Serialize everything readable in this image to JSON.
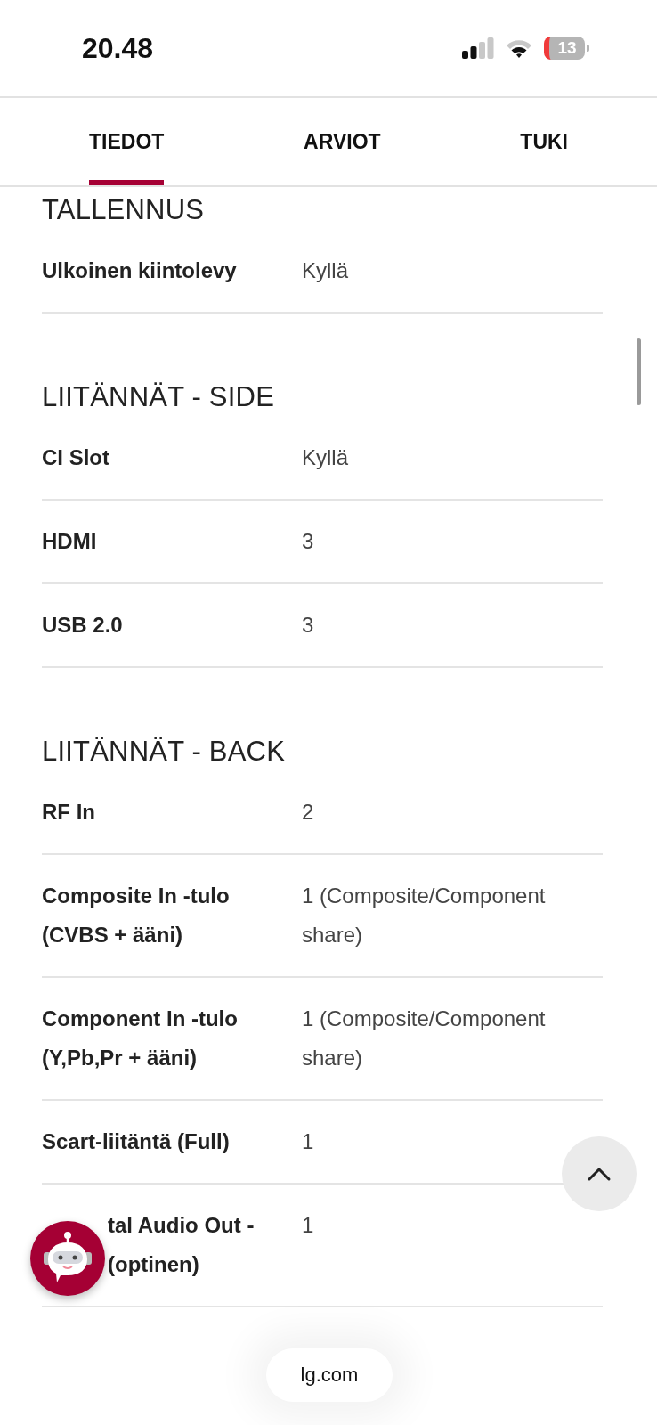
{
  "status_bar": {
    "time": "20.48",
    "battery": "13"
  },
  "tabs": [
    {
      "label": "TIEDOT",
      "selected": true
    },
    {
      "label": "ARVIOT",
      "selected": false
    },
    {
      "label": "TUKI",
      "selected": false
    }
  ],
  "sections": [
    {
      "title": "TALLENNUS",
      "rows": [
        {
          "label": [
            "Ulkoinen kiintolevy"
          ],
          "value": [
            "Kyllä"
          ]
        }
      ]
    },
    {
      "title": "LIITÄNNÄT - SIDE",
      "rows": [
        {
          "label": [
            "CI Slot"
          ],
          "value": [
            "Kyllä"
          ]
        },
        {
          "label": [
            "HDMI"
          ],
          "value": [
            "3"
          ]
        },
        {
          "label": [
            "USB 2.0"
          ],
          "value": [
            "3"
          ]
        }
      ]
    },
    {
      "title": "LIITÄNNÄT - BACK",
      "rows": [
        {
          "label": [
            "RF In"
          ],
          "value": [
            "2"
          ]
        },
        {
          "label": [
            "Composite In -tulo",
            "(CVBS + ääni)"
          ],
          "value": [
            "1 (Composite/Component",
            "share)"
          ]
        },
        {
          "label": [
            "Component In -tulo",
            "(Y,Pb,Pr + ääni)"
          ],
          "value": [
            "1 (Composite/Component",
            "share)"
          ]
        },
        {
          "label": [
            "Scart-liitäntä (Full)"
          ],
          "value": [
            "1"
          ]
        },
        {
          "label": [
            "tal Audio Out -",
            "(optinen)"
          ],
          "value": [
            "1"
          ],
          "kind": "covered"
        }
      ]
    }
  ],
  "address": "lg.com"
}
